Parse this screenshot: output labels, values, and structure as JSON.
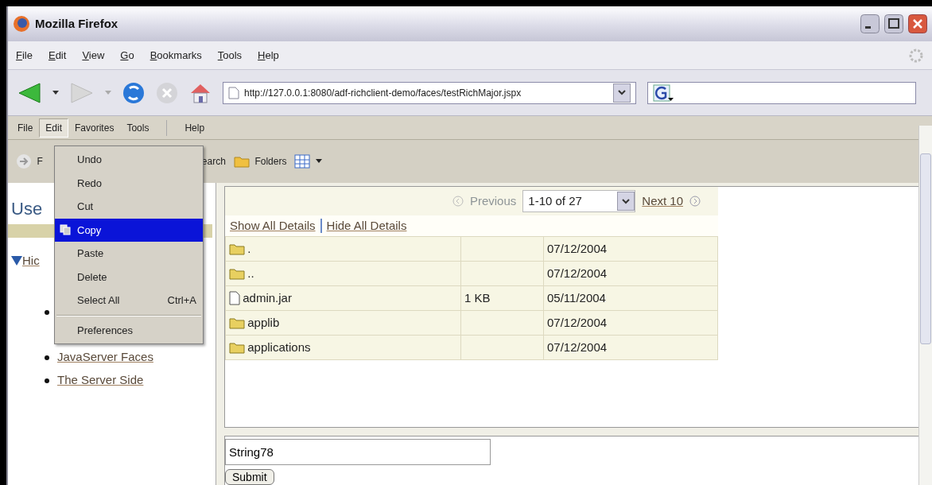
{
  "window": {
    "title": "Mozilla Firefox"
  },
  "browser_menu": [
    "File",
    "Edit",
    "View",
    "Go",
    "Bookmarks",
    "Tools",
    "Help"
  ],
  "address": {
    "value": "http://127.0.0.1:8080/adf-richclient-demo/faces/testRichMajor.jspx"
  },
  "app_menu": [
    {
      "label": "File",
      "selected": false
    },
    {
      "label": "Edit",
      "selected": true
    },
    {
      "label": "Favorites",
      "selected": false
    },
    {
      "label": "Tools",
      "selected": false
    },
    {
      "label": "Help",
      "selected": false
    }
  ],
  "toolbar": [
    {
      "kind": "forward",
      "label": "F"
    },
    {
      "kind": "search",
      "label": "earch"
    },
    {
      "kind": "folders",
      "label": "Folders"
    },
    {
      "kind": "views"
    }
  ],
  "edit_menu": [
    {
      "kind": "item",
      "label": "Undo",
      "selected": false
    },
    {
      "kind": "item",
      "label": "Redo",
      "selected": false
    },
    {
      "kind": "item",
      "label": "Cut",
      "selected": false
    },
    {
      "kind": "item",
      "label": "Copy",
      "selected": true
    },
    {
      "kind": "item",
      "label": "Paste",
      "selected": false
    },
    {
      "kind": "item",
      "label": "Delete",
      "selected": false
    },
    {
      "kind": "item",
      "label": "Select All",
      "shortcut": "Ctrl+A",
      "selected": false
    },
    {
      "kind": "separator"
    },
    {
      "kind": "item",
      "label": "Preferences",
      "selected": false
    }
  ],
  "sidebar": {
    "heading": "Use",
    "node": {
      "label": "Hic",
      "expanded": true
    },
    "links": [
      {
        "covered": true
      },
      {
        "covered": false,
        "label": "JavaServer Faces"
      },
      {
        "covered": false,
        "label": "The Server Side"
      }
    ]
  },
  "pager": {
    "previous": "Previous",
    "range": "1-10 of 27",
    "next": "Next 10"
  },
  "details_links": [
    "Show All Details",
    "Hide All Details"
  ],
  "files": [
    {
      "kind": "folder",
      "name": ".",
      "date": "07/12/2004"
    },
    {
      "kind": "folder",
      "name": "..",
      "date": "07/12/2004"
    },
    {
      "kind": "file",
      "name": "admin.jar",
      "size": "1 KB",
      "date": "05/11/2004"
    },
    {
      "kind": "folder",
      "name": "applib",
      "date": "07/12/2004"
    },
    {
      "kind": "folder",
      "name": "applications",
      "date": "07/12/2004"
    }
  ],
  "form": {
    "value": "String78",
    "button": "Submit"
  }
}
